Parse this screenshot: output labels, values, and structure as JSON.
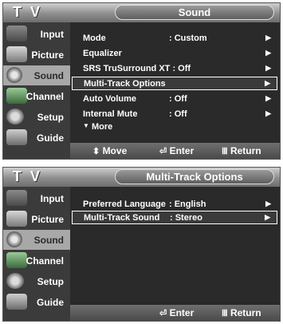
{
  "panels": [
    {
      "tv_label": "T V",
      "title": "Sound",
      "sidebar": [
        {
          "label": "Input",
          "icon": "input-icon"
        },
        {
          "label": "Picture",
          "icon": "picture-icon"
        },
        {
          "label": "Sound",
          "icon": "speaker-icon",
          "active": true
        },
        {
          "label": "Channel",
          "icon": "channel-icon"
        },
        {
          "label": "Setup",
          "icon": "setup-icon"
        },
        {
          "label": "Guide",
          "icon": "guide-icon"
        }
      ],
      "items": [
        {
          "name": "Mode",
          "value": ": Custom"
        },
        {
          "name": "Equalizer",
          "value": ""
        },
        {
          "name": "SRS TruSurround XT : Off",
          "value": ""
        },
        {
          "name": "Multi-Track Options",
          "value": "",
          "highlighted": true
        },
        {
          "name": "Auto Volume",
          "value": ": Off"
        },
        {
          "name": "Internal Mute",
          "value": ": Off"
        }
      ],
      "more_label": "More",
      "footer": {
        "move": "Move",
        "enter": "Enter",
        "return": "Return"
      }
    },
    {
      "tv_label": "T V",
      "title": "Multi-Track Options",
      "sidebar": [
        {
          "label": "Input",
          "icon": "input-icon"
        },
        {
          "label": "Picture",
          "icon": "picture-icon"
        },
        {
          "label": "Sound",
          "icon": "speaker-icon",
          "active": true
        },
        {
          "label": "Channel",
          "icon": "channel-icon"
        },
        {
          "label": "Setup",
          "icon": "setup-icon"
        },
        {
          "label": "Guide",
          "icon": "guide-icon"
        }
      ],
      "items": [
        {
          "name": "Preferred Language",
          "value": ": English"
        },
        {
          "name": "Multi-Track Sound",
          "value": ": Stereo",
          "highlighted": true
        }
      ],
      "footer": {
        "enter": "Enter",
        "return": "Return"
      }
    }
  ],
  "glyphs": {
    "arrow": "▶",
    "more": "▼",
    "move": "⬍",
    "enter": "⏎",
    "return": "Ⅲ"
  }
}
